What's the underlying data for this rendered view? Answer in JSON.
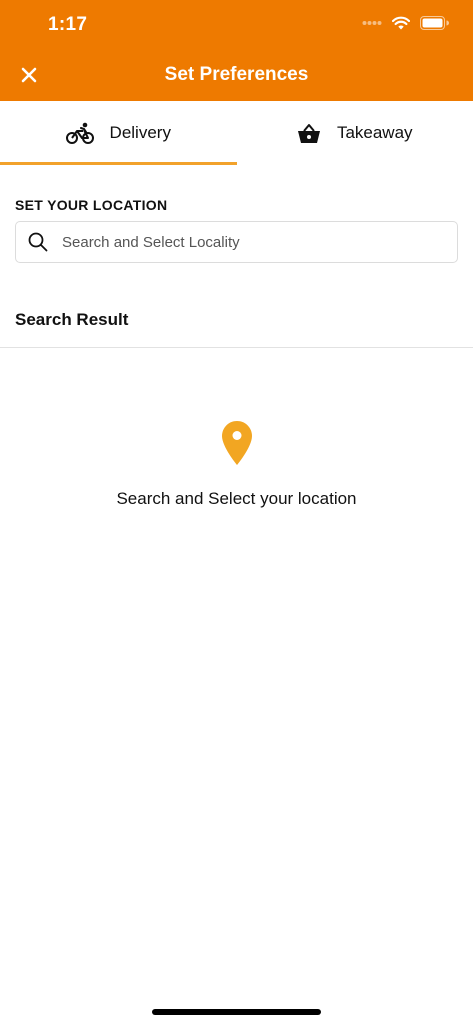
{
  "status_bar": {
    "time": "1:17"
  },
  "header": {
    "title": "Set Preferences",
    "close_icon": "close-icon"
  },
  "tabs": [
    {
      "label": "Delivery",
      "icon": "bicycle-icon",
      "active": true
    },
    {
      "label": "Takeaway",
      "icon": "basket-icon",
      "active": false
    }
  ],
  "location": {
    "section_label": "SET YOUR LOCATION",
    "search_placeholder": "Search and Select Locality",
    "search_value": ""
  },
  "results": {
    "title": "Search Result",
    "empty_message": "Search and Select your location",
    "empty_icon": "location-pin-icon"
  },
  "colors": {
    "header_bg": "#EE7A00",
    "accent": "#F2A22B",
    "pin": "#F2A622"
  }
}
